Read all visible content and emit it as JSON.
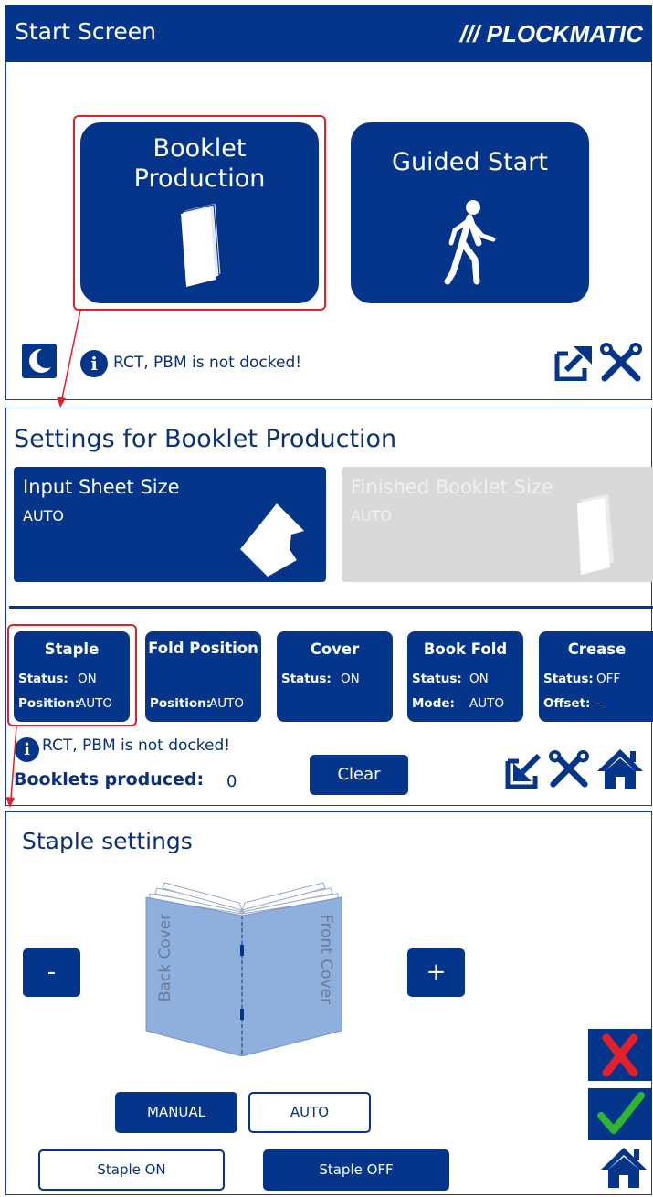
{
  "start_screen": {
    "title": "Start Screen",
    "logo": "/// PLOCKMATIC",
    "booklet_button_line1": "Booklet",
    "booklet_button_line2": "Production",
    "guided_button_label": "Guided Start",
    "info_message": "RCT, PBM is not docked!",
    "icons": [
      "sleep-icon",
      "info-icon",
      "export-icon",
      "tools-icon"
    ]
  },
  "booklet_settings": {
    "title": "Settings for Booklet Production",
    "input_sheet": {
      "label": "Input Sheet Size",
      "value": "AUTO"
    },
    "finished_size": {
      "label": "Finished Booklet Size",
      "value": "AUTO"
    },
    "functions": [
      {
        "title": "Staple",
        "rows": [
          {
            "k": "Status:",
            "v": "ON"
          },
          {
            "k": "Position:",
            "v": "AUTO"
          }
        ]
      },
      {
        "title": "Fold Position",
        "rows": [
          {
            "k": "Position:",
            "v": "AUTO"
          }
        ]
      },
      {
        "title": "Cover",
        "rows": [
          {
            "k": "Status:",
            "v": "ON"
          }
        ]
      },
      {
        "title": "Book Fold",
        "rows": [
          {
            "k": "Status:",
            "v": "ON"
          },
          {
            "k": "Mode:",
            "v": "AUTO"
          }
        ]
      },
      {
        "title": "Crease",
        "rows": [
          {
            "k": "Status:",
            "v": "OFF"
          },
          {
            "k": "Offset:",
            "v": "-"
          }
        ]
      }
    ],
    "info_message": "RCT, PBM is not docked!",
    "booklets_label": "Booklets produced:",
    "booklets_count": "0",
    "clear_label": "Clear"
  },
  "staple_settings": {
    "title": "Staple settings",
    "minus_label": "-",
    "plus_label": "+",
    "back_cover_label": "Back Cover",
    "front_cover_label": "Front Cover",
    "manual_label": "MANUAL",
    "auto_label": "AUTO",
    "staple_on_label": "Staple ON",
    "staple_off_label": "Staple OFF"
  },
  "colors": {
    "navy": "#05358a",
    "highlight": "#e0202a",
    "disabled": "#d9d9d9",
    "book": "#8fafdc",
    "check": "#2fb52f"
  }
}
